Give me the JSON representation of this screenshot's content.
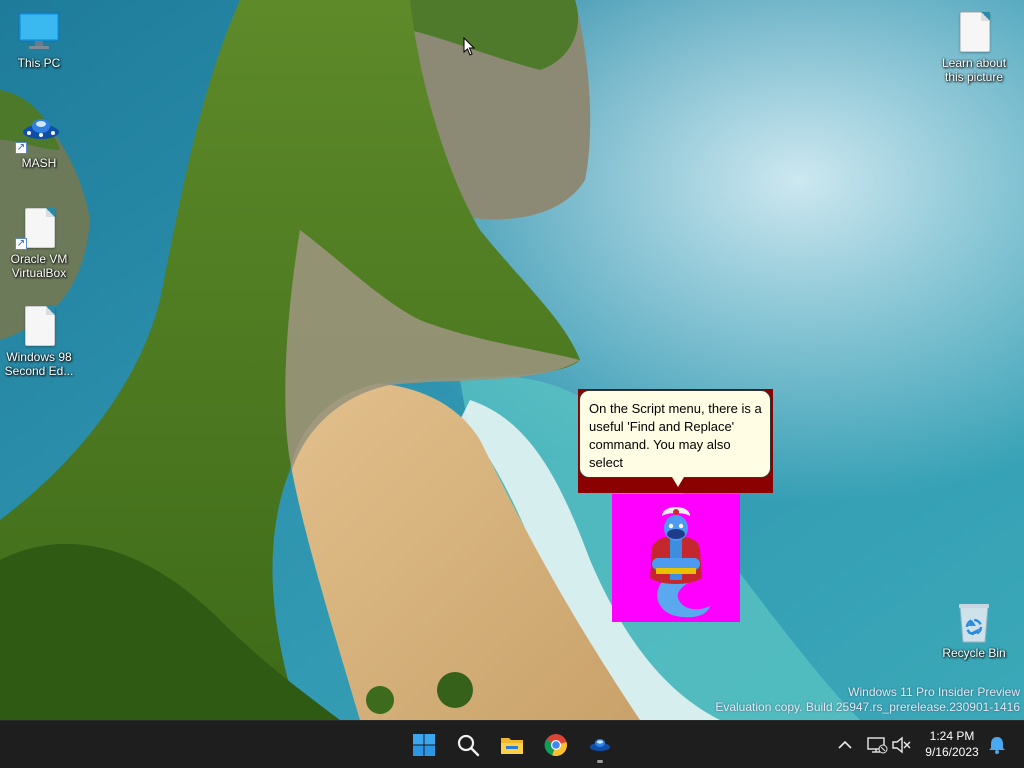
{
  "desktop": {
    "icons": [
      {
        "label": "This PC",
        "icon": "monitor-icon"
      },
      {
        "label": "MASH",
        "icon": "mash-app-icon"
      },
      {
        "label": "Oracle VM VirtualBox",
        "icon": "document-icon"
      },
      {
        "label": "Windows 98 Second Ed...",
        "icon": "document-icon"
      },
      {
        "label": "Learn about this picture",
        "icon": "document-icon"
      },
      {
        "label": "Recycle Bin",
        "icon": "recycle-bin-icon"
      }
    ],
    "watermark": {
      "line1": "Windows 11 Pro Insider Preview",
      "line2": "Evaluation copy. Build 25947.rs_prerelease.230901-1416"
    }
  },
  "agent": {
    "balloon_text": "On the Script menu, there is a useful 'Find and Replace' command. You may also select",
    "character": "genie",
    "chroma_color": "#ff00ff",
    "balloon_frame_color": "#8b0000"
  },
  "taskbar": {
    "apps": [
      {
        "name": "Start",
        "icon": "windows-start-icon"
      },
      {
        "name": "Search",
        "icon": "search-icon"
      },
      {
        "name": "File Explorer",
        "icon": "folder-icon"
      },
      {
        "name": "Google Chrome",
        "icon": "chrome-icon"
      },
      {
        "name": "MASH",
        "icon": "mash-app-icon",
        "running": true
      }
    ],
    "tray": {
      "time": "1:24 PM",
      "date": "9/16/2023"
    }
  }
}
